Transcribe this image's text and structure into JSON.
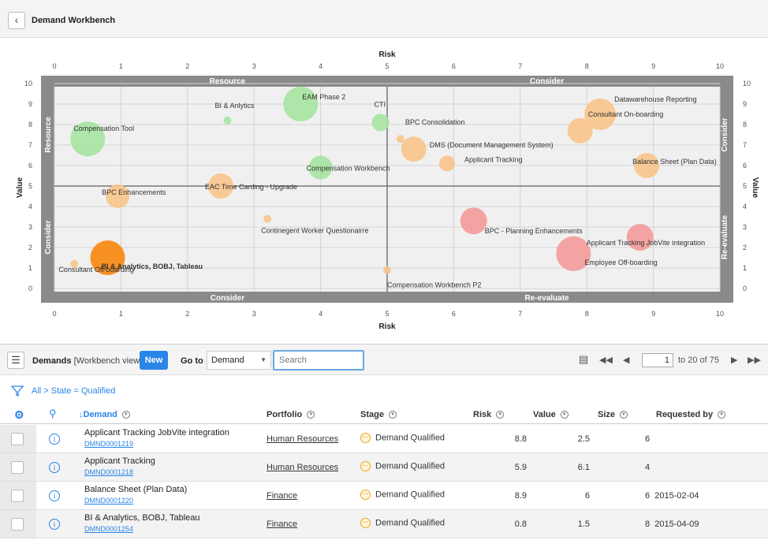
{
  "header": {
    "title": "Demand Workbench",
    "back_icon": "chevron-left-icon"
  },
  "chart_data": {
    "type": "scatter",
    "title": "",
    "xlabel": "Risk",
    "ylabel": "Value",
    "xlim": [
      0,
      10
    ],
    "ylim": [
      0,
      10
    ],
    "x_ticks": [
      "0",
      "1",
      "2",
      "3",
      "4",
      "5",
      "6",
      "7",
      "8",
      "9",
      "10"
    ],
    "y_ticks": [
      "0",
      "1",
      "2",
      "3",
      "4",
      "5",
      "6",
      "7",
      "8",
      "9",
      "10"
    ],
    "quadrants": {
      "top_left": "Resource",
      "top_right": "Consider",
      "bottom_left": "Consider",
      "bottom_right": "Re-evaluate",
      "left_upper": "Resource",
      "left_lower": "Consider",
      "right_upper": "Consider",
      "right_lower": "Re-evaluate"
    },
    "colors": {
      "green": "#a6e3a0",
      "orange": "#f8c48a",
      "red": "#f49a9a",
      "dark_orange": "#f8860d"
    },
    "points": [
      {
        "name": "Compensation Tool",
        "x": 0.5,
        "y": 7.3,
        "r": 22,
        "color": "green",
        "label_dx": -18,
        "label_dy": -10
      },
      {
        "name": "BI & Anlytics",
        "x": 2.6,
        "y": 8.2,
        "r": 5,
        "color": "green",
        "label_dx": -16,
        "label_dy": -16
      },
      {
        "name": "EAM Phase 2",
        "x": 3.7,
        "y": 9.0,
        "r": 22,
        "color": "green",
        "label_dx": 2,
        "label_dy": -6
      },
      {
        "name": "CTI",
        "x": 4.9,
        "y": 8.1,
        "r": 11,
        "color": "green",
        "label_dx": -8,
        "label_dy": -20
      },
      {
        "name": "Compensation Workbench",
        "x": 4.0,
        "y": 5.9,
        "r": 15,
        "color": "green",
        "label_dx": -18,
        "label_dy": 4
      },
      {
        "name": "BPC Consolidation",
        "x": 5.2,
        "y": 7.3,
        "r": 5,
        "color": "orange",
        "label_dx": 6,
        "label_dy": -18
      },
      {
        "name": "DMS (Document Management System)",
        "x": 5.4,
        "y": 6.8,
        "r": 16,
        "color": "orange",
        "label_dx": 20,
        "label_dy": -2
      },
      {
        "name": "Applicant Tracking",
        "x": 5.9,
        "y": 6.1,
        "r": 10,
        "color": "orange",
        "label_dx": 22,
        "label_dy": -2
      },
      {
        "name": "Datawarehouse Reporting",
        "x": 8.2,
        "y": 8.5,
        "r": 20,
        "color": "orange",
        "label_dx": 18,
        "label_dy": -16
      },
      {
        "name": "Consultant On-boarding",
        "x": 7.9,
        "y": 7.7,
        "r": 16,
        "color": "orange",
        "label_dx": 10,
        "label_dy": -18
      },
      {
        "name": "Balance Sheet (Plan Data)",
        "x": 8.9,
        "y": 6.0,
        "r": 16,
        "color": "orange",
        "label_dx": -18,
        "label_dy": -2
      },
      {
        "name": "EAC Time Carding - Upgrade",
        "x": 2.5,
        "y": 5.0,
        "r": 16,
        "color": "orange",
        "label_dx": -20,
        "label_dy": 4
      },
      {
        "name": "BPC Enhancements",
        "x": 0.95,
        "y": 4.5,
        "r": 15,
        "color": "orange",
        "label_dx": -20,
        "label_dy": -2
      },
      {
        "name": "Continegent Worker Questionairre",
        "x": 3.2,
        "y": 3.4,
        "r": 5,
        "color": "orange",
        "label_dx": -8,
        "label_dy": 18
      },
      {
        "name": "Consultant Off-boarding",
        "x": 0.3,
        "y": 1.2,
        "r": 5,
        "color": "orange",
        "label_dx": -20,
        "label_dy": 10
      },
      {
        "name": "BI & Analytics, BOBJ, Tableau",
        "x": 0.8,
        "y": 1.5,
        "r": 22,
        "color": "dark_orange",
        "label_dx": -8,
        "label_dy": 14
      },
      {
        "name": "Compensation Workbench P2",
        "x": 5.0,
        "y": 0.9,
        "r": 5,
        "color": "orange",
        "label_dx": 0,
        "label_dy": 22
      },
      {
        "name": "BPC - Planning Enhancements",
        "x": 6.3,
        "y": 3.3,
        "r": 17,
        "color": "red",
        "label_dx": 14,
        "label_dy": 16
      },
      {
        "name": "Applicant Tracking JobVite integration",
        "x": 8.8,
        "y": 2.5,
        "r": 17,
        "color": "red",
        "label_dx": -68,
        "label_dy": 10
      },
      {
        "name": "Employee Off-boarding",
        "x": 7.8,
        "y": 1.7,
        "r": 22,
        "color": "red",
        "label_dx": 14,
        "label_dy": 14
      }
    ]
  },
  "listbar": {
    "menu_icon": "hamburger-icon",
    "title": "Demands",
    "view": "[Workbench view]",
    "new_label": "New",
    "goto_label": "Go to",
    "goto_value": "Demand",
    "search_placeholder": "Search",
    "page_value": "1",
    "page_total": "to 20 of 75"
  },
  "filter": {
    "text": "All > State = Qualified"
  },
  "table": {
    "headers": {
      "demand": "Demand",
      "portfolio": "Portfolio",
      "stage": "Stage",
      "risk": "Risk",
      "value": "Value",
      "size": "Size",
      "requested_by": "Requested by"
    },
    "rows": [
      {
        "name": "Applicant Tracking JobVite integration",
        "id": "DMND0001219",
        "portfolio": "Human Resources",
        "stage": "Demand Qualified",
        "risk": "8.8",
        "value": "2.5",
        "size": "6",
        "requested_by": ""
      },
      {
        "name": "Applicant Tracking",
        "id": "DMND0001218",
        "portfolio": "Human Resources",
        "stage": "Demand Qualified",
        "risk": "5.9",
        "value": "6.1",
        "size": "4",
        "requested_by": ""
      },
      {
        "name": "Balance Sheet (Plan Data)",
        "id": "DMND0001220",
        "portfolio": "Finance",
        "stage": "Demand Qualified",
        "risk": "8.9",
        "value": "6",
        "size": "6",
        "requested_by": "2015-02-04"
      },
      {
        "name": "BI & Analytics, BOBJ, Tableau",
        "id": "DMND0001254",
        "portfolio": "Finance",
        "stage": "Demand Qualified",
        "risk": "0.8",
        "value": "1.5",
        "size": "8",
        "requested_by": "2015-04-09"
      }
    ]
  }
}
